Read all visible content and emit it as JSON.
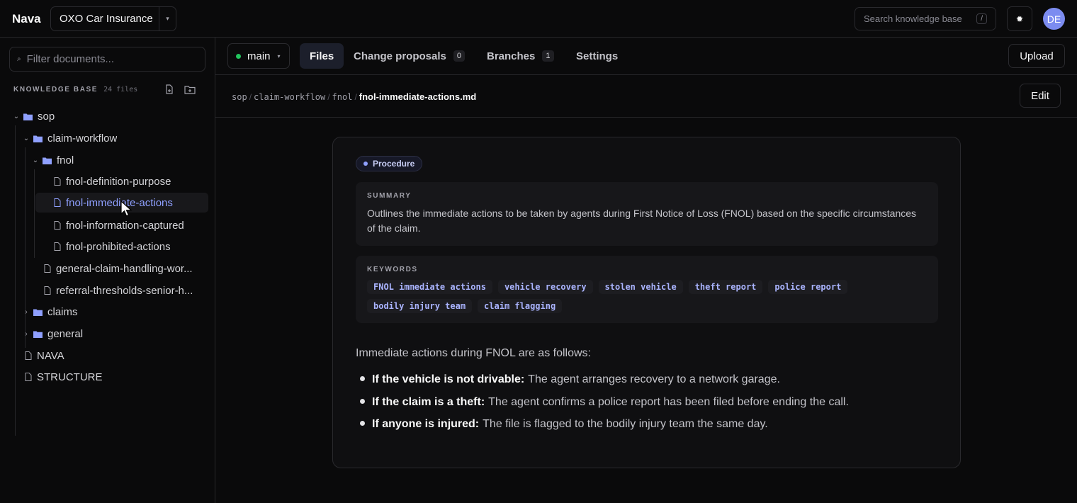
{
  "topbar": {
    "brand": "Nava",
    "project": "OXO Car Insurance",
    "search_placeholder": "Search knowledge base",
    "search_shortcut": "/",
    "avatar_initials": "DE",
    "accent": "#7c8cf0"
  },
  "sidebar": {
    "filter_placeholder": "Filter documents...",
    "kb_title": "KNOWLEDGE BASE",
    "kb_count": "24 files",
    "tree": [
      {
        "label": "sop",
        "type": "folder",
        "expanded": true
      },
      {
        "label": "claim-workflow",
        "type": "folder",
        "expanded": true
      },
      {
        "label": "fnol",
        "type": "folder",
        "expanded": true
      },
      {
        "label": "fnol-definition-purpose",
        "type": "file"
      },
      {
        "label": "fnol-immediate-actions",
        "type": "file",
        "selected": true
      },
      {
        "label": "fnol-information-captured",
        "type": "file"
      },
      {
        "label": "fnol-prohibited-actions",
        "type": "file"
      },
      {
        "label": "general-claim-handling-wor...",
        "type": "file"
      },
      {
        "label": "referral-thresholds-senior-h...",
        "type": "file"
      },
      {
        "label": "claims",
        "type": "folder",
        "expanded": false
      },
      {
        "label": "general",
        "type": "folder",
        "expanded": false
      },
      {
        "label": "NAVA",
        "type": "file"
      },
      {
        "label": "STRUCTURE",
        "type": "file"
      }
    ]
  },
  "tabsbar": {
    "branch": "main",
    "tabs": [
      {
        "label": "Files",
        "active": true
      },
      {
        "label": "Change proposals",
        "count": "0"
      },
      {
        "label": "Branches",
        "count": "1"
      },
      {
        "label": "Settings"
      }
    ],
    "upload_label": "Upload"
  },
  "breadcrumb": {
    "segments": [
      "sop",
      "claim-workflow",
      "fnol"
    ],
    "current": "fnol-immediate-actions.md",
    "edit_label": "Edit"
  },
  "document": {
    "badge": "Procedure",
    "summary_title": "SUMMARY",
    "summary": "Outlines the immediate actions to be taken by agents during First Notice of Loss (FNOL) based on the specific circumstances of the claim.",
    "keywords_title": "KEYWORDS",
    "keywords": [
      "FNOL immediate actions",
      "vehicle recovery",
      "stolen vehicle",
      "theft report",
      "police report",
      "bodily injury team",
      "claim flagging"
    ],
    "intro": "Immediate actions during FNOL are as follows:",
    "bullets": [
      {
        "bold": "If the vehicle is not drivable:",
        "text": "The agent arranges recovery to a network garage."
      },
      {
        "bold": "If the claim is a theft:",
        "text": "The agent confirms a police report has been filed before ending the call."
      },
      {
        "bold": "If anyone is injured:",
        "text": "The file is flagged to the bodily injury team the same day."
      }
    ]
  }
}
